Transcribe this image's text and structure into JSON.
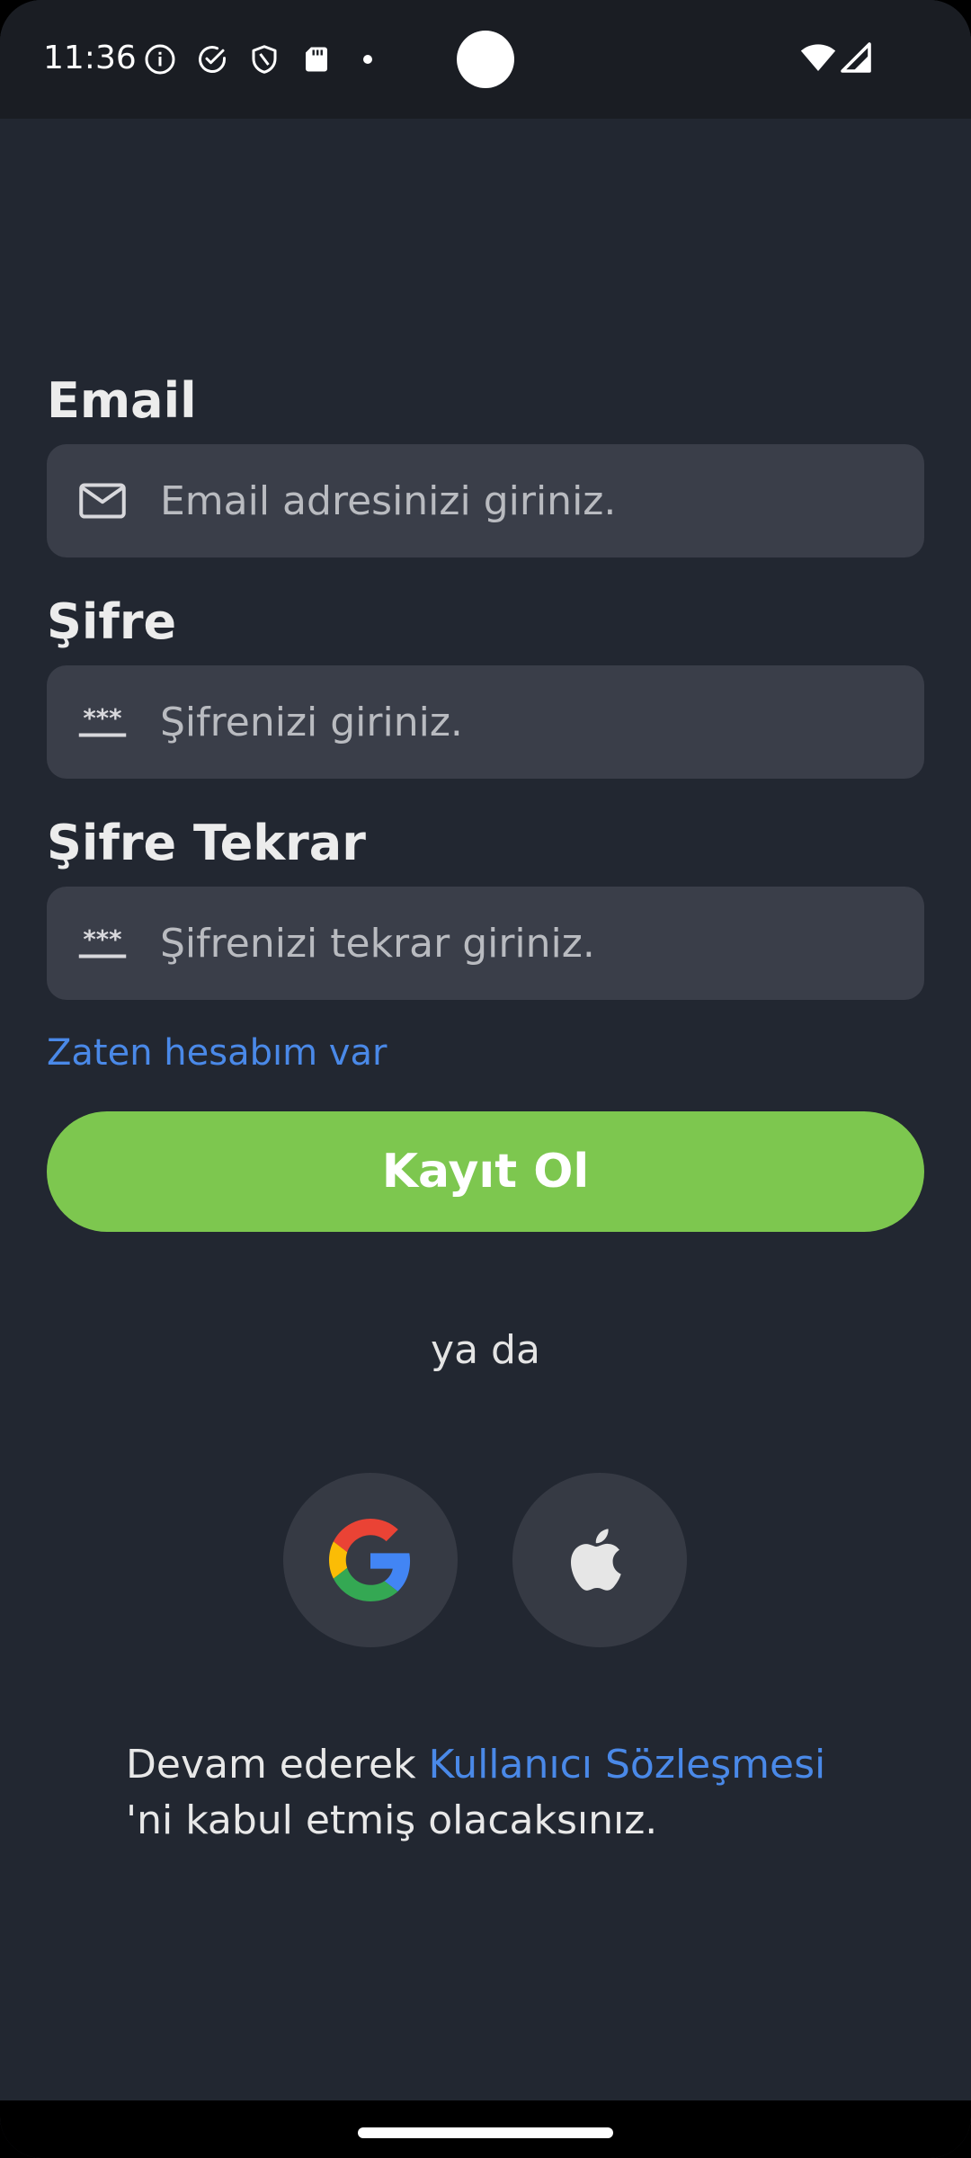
{
  "status_bar": {
    "time": "11:36",
    "icons": [
      "info-icon",
      "check-circle-icon",
      "shield-icon",
      "sd-card-icon",
      "notification-dot",
      "wifi-icon",
      "signal-icon"
    ]
  },
  "form": {
    "email": {
      "label": "Email",
      "placeholder": "Email adresinizi giriniz.",
      "icon": "mail-icon"
    },
    "password": {
      "label": "Şifre",
      "placeholder": "Şifrenizi giriniz.",
      "icon": "password-icon"
    },
    "password_repeat": {
      "label": "Şifre Tekrar",
      "placeholder": "Şifrenizi tekrar giriniz.",
      "icon": "password-icon"
    }
  },
  "login_link": "Zaten hesabım var",
  "register_button": "Kayıt Ol",
  "divider": "ya da",
  "social": {
    "google_icon": "google-icon",
    "apple_icon": "apple-icon"
  },
  "terms": {
    "prefix": "Devam ederek ",
    "link": "Kullanıcı Sözleşmesi",
    "suffix": "'ni kabul etmiş olacaksınız."
  },
  "colors": {
    "background": "#222731",
    "input_background": "#3a3e49",
    "accent_green": "#7dc74f",
    "link_blue": "#4a89e8"
  }
}
